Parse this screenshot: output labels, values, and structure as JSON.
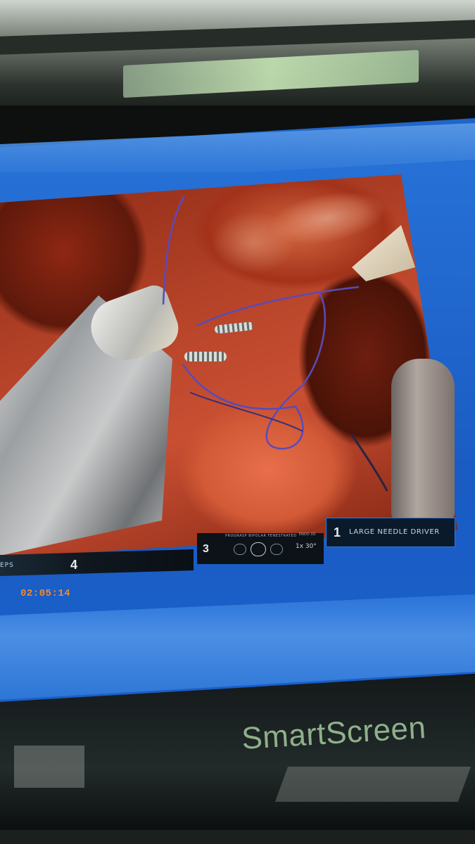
{
  "photo": {
    "monitor_brand": "SmartScreen"
  },
  "video": {
    "elapsed_time": "02:05:14"
  },
  "instrument_slots": [
    {
      "arm": "4",
      "tool_label_fragment": "EPS"
    },
    {
      "arm": "3",
      "tool_name": "PROGRASP BIPOLAR FENESTRATED",
      "control_label": "ENDO 3D",
      "scope_setting": "1x 30°"
    },
    {
      "arm": "1",
      "tool_name": "LARGE NEEDLE DRIVER"
    }
  ],
  "colors": {
    "screen_frame": "#1f64c8",
    "timer": "#f28a2a",
    "brand_text": "#8fb08a",
    "active_slot_border": "#2f7ae0"
  }
}
